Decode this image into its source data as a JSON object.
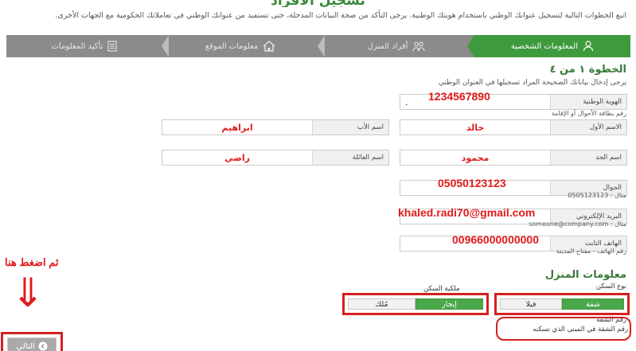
{
  "page": {
    "title": "تسجيل الأفراد",
    "intro": "اتبع الخطوات التالية لتسجيل عنوانك الوطني باستخدام هويتك الوطنية. يرجى التأكد من صحة البيانات المدخلة، حتى تستفيد من عنوانك الوطني في تعاملاتك الحكومية مع الجهات الأخرى."
  },
  "steps": [
    {
      "label": "المعلومات الشخصية",
      "icon": "person-icon",
      "active": true
    },
    {
      "label": "أفراد المنزل",
      "icon": "family-icon",
      "active": false
    },
    {
      "label": "معلومات الموقع",
      "icon": "home-icon",
      "active": false
    },
    {
      "label": "تأكيد المعلومات",
      "icon": "document-icon",
      "active": false
    }
  ],
  "step_heading": "الخطوة ١ من ٤",
  "step_subtext": "يرجى إدخال بياناتك الصحيحة المراد تسجيلها في العنوان الوطني",
  "form": {
    "national_id": {
      "label": "الهوية الوطنية",
      "value": "1234567890",
      "placeholder": ".",
      "hint": "رقم بطاقة الأحوال أو الإقامة"
    },
    "first_name": {
      "label": "الاسم الأول",
      "value": "خالد"
    },
    "father_name": {
      "label": "اسم الأب",
      "value": "ابراهيم"
    },
    "grandfather_name": {
      "label": "اسم الجد",
      "value": "محمود"
    },
    "family_name": {
      "label": "اسم العائلة",
      "value": "راضي"
    },
    "mobile": {
      "label": "الجوال",
      "value": "05050123123",
      "hint": "مثال : 0505123123"
    },
    "email": {
      "label": "البريد الإلكتروني",
      "value": "khaled.radi70@gmail.com",
      "hint": "مثال : someone@company.com"
    },
    "landline": {
      "label": "الهاتف الثابت",
      "value": "00966000000000",
      "hint": "رقم الهاتف - مفتاح المدينة"
    }
  },
  "housing": {
    "heading": "معلومات المنزل",
    "type_label": "نوع السكن",
    "type_options": [
      {
        "label": "شقة",
        "selected": true
      },
      {
        "label": "فيلا",
        "selected": false
      }
    ],
    "ownership_label": "ملكية السكن",
    "ownership_options": [
      {
        "label": "إيجار",
        "selected": true
      },
      {
        "label": "مُلك",
        "selected": false
      }
    ],
    "apartment_label": "رقم الشقة",
    "apartment_hint": "رقم الشقة في المبنى الذي تسكنه"
  },
  "annotation": {
    "text": "ثم اضغط هنا",
    "arrow": "⇓"
  },
  "next_button": {
    "label": "التالي"
  },
  "colors": {
    "primary_green": "#3d9a3d",
    "annotation_red": "#d42020",
    "stepbar_gray": "#8b8b8b"
  }
}
